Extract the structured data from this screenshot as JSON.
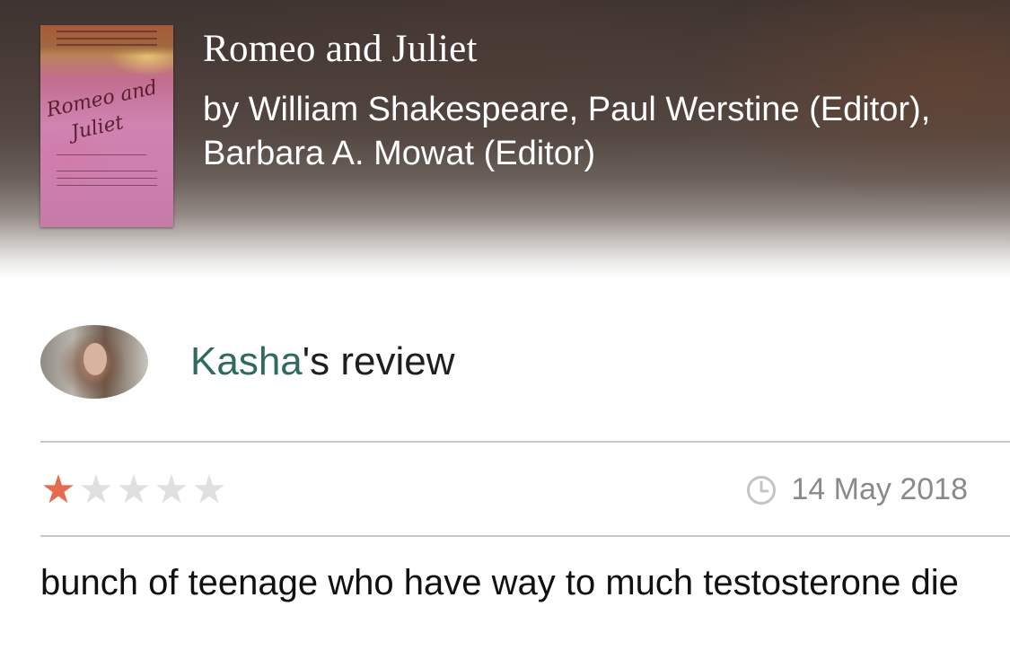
{
  "book": {
    "title": "Romeo and Juliet",
    "authors": "by William Shakespeare, Paul Werstine (Editor), Barbara A. Mowat (Editor)",
    "cover_icon": "book-cover-romeo-and-juliet"
  },
  "review": {
    "reviewer_name": "Kasha",
    "heading_suffix": "'s review",
    "rating": 1,
    "rating_max": 5,
    "date": "14 May 2018",
    "body": "bunch of teenage who have way to much testosterone die"
  },
  "colors": {
    "reviewer_link": "#2f6b5c",
    "star_filled": "#e46a50",
    "star_empty": "#e0e0e0",
    "date_text": "#8a8a8a"
  },
  "icons": {
    "clock": "clock-icon",
    "star": "star-icon",
    "avatar": "reviewer-avatar"
  }
}
